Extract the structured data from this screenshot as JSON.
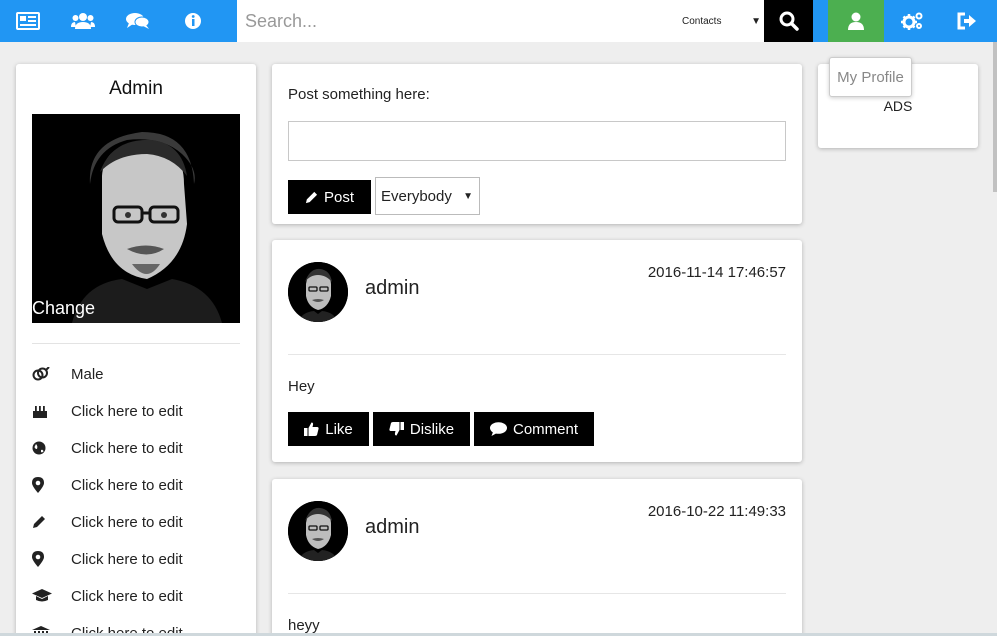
{
  "nav": {
    "icons": [
      "newspaper-icon",
      "users-icon",
      "comments-icon",
      "info-icon"
    ],
    "search_placeholder": "Search...",
    "search_scope": "Contacts",
    "right_icons": [
      "search-icon",
      "user-icon",
      "cogs-icon",
      "sign-out-icon"
    ],
    "tooltip": "My Profile"
  },
  "colors": {
    "nav_blue": "#2196f3",
    "profile_green": "#4caf50",
    "button_black": "#000000"
  },
  "profile": {
    "name": "Admin",
    "photo_action": "Change",
    "fields": [
      {
        "icon": "gender-icon",
        "text": "Male"
      },
      {
        "icon": "birthday-cake-icon",
        "text": "Click here to edit"
      },
      {
        "icon": "globe-icon",
        "text": "Click here to edit"
      },
      {
        "icon": "map-marker-icon",
        "text": "Click here to edit"
      },
      {
        "icon": "pencil-icon",
        "text": "Click here to edit"
      },
      {
        "icon": "map-marker-icon",
        "text": "Click here to edit"
      },
      {
        "icon": "graduation-cap-icon",
        "text": "Click here to edit"
      },
      {
        "icon": "institution-icon",
        "text": "Click here to edit"
      }
    ]
  },
  "composer": {
    "label": "Post something here:",
    "input_value": "",
    "post_label": "Post",
    "audience": "Everybody"
  },
  "posts": [
    {
      "author": "admin",
      "timestamp": "2016-11-14 17:46:57",
      "text": "Hey",
      "actions": {
        "like": "Like",
        "dislike": "Dislike",
        "comment": "Comment"
      }
    },
    {
      "author": "admin",
      "timestamp": "2016-10-22 11:49:33",
      "text": "heyy"
    }
  ],
  "sidebar_right": {
    "ads_label": "ADS"
  }
}
